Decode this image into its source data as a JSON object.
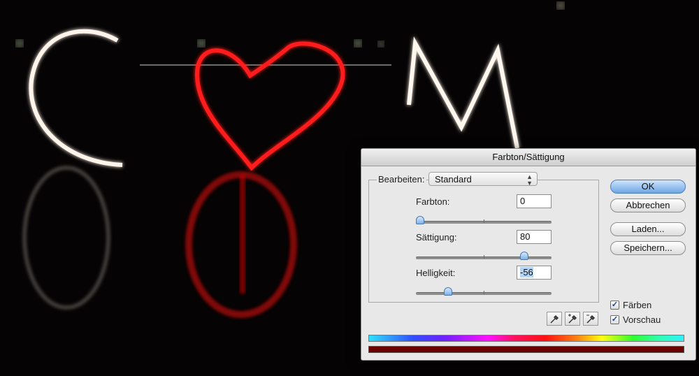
{
  "dialog": {
    "title": "Farbton/Sättigung",
    "edit_label": "Bearbeiten:",
    "edit_value": "Standard",
    "sliders": [
      {
        "label": "Farbton:",
        "value": "0",
        "fraction": 0.0
      },
      {
        "label": "Sättigung:",
        "value": "80",
        "fraction": 0.82
      },
      {
        "label": "Helligkeit:",
        "value": "-56",
        "fraction": 0.22
      }
    ],
    "buttons": {
      "ok": "OK",
      "cancel": "Abbrechen",
      "load": "Laden...",
      "save": "Speichern..."
    },
    "checkboxes": {
      "colorize": {
        "label": "Färben",
        "checked": true
      },
      "preview": {
        "label": "Vorschau",
        "checked": true
      }
    },
    "eyedroppers": [
      "eyedropper-icon",
      "eyedropper-plus-icon",
      "eyedropper-minus-icon"
    ],
    "result_color": "#6b0000"
  },
  "colors": {
    "accent": "#6ea6e4",
    "photo_red": "#e01010"
  }
}
